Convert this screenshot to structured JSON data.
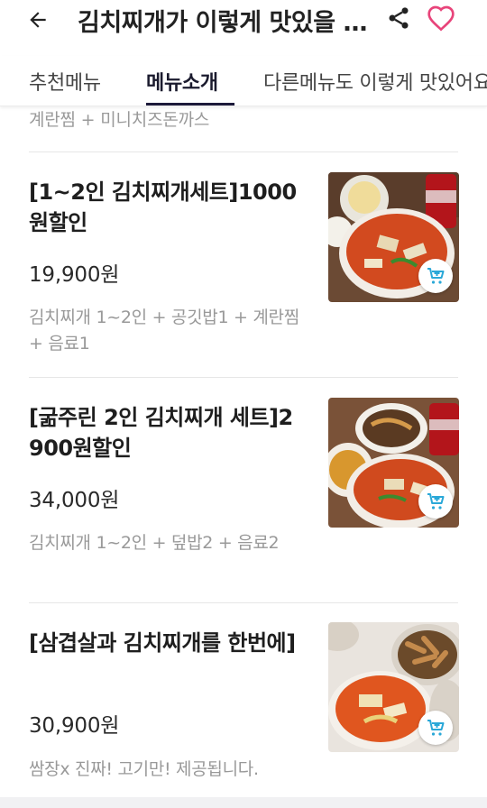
{
  "header": {
    "title": "김치찌개가 이렇게 맛있을 수 있나요",
    "back_icon": "back-arrow-icon",
    "share_icon": "share-icon",
    "heart_icon": "heart-outline-icon",
    "heart_color": "#e8447a"
  },
  "tabs": [
    {
      "label": "추천메뉴",
      "active": false
    },
    {
      "label": "메뉴소개",
      "active": true
    },
    {
      "label": "다른메뉴도 이렇게 맛있어요",
      "active": false
    }
  ],
  "previous_item_desc_tail": "계란찜 + 미니치즈돈까스",
  "menu_items": [
    {
      "name": "[1~2인 김치찌개세트]1000원할인",
      "price": "19,900원",
      "description": "김치찌개 1~2인 + 공깃밥1 + 계란찜 + 음료1",
      "cart_icon": "add-to-cart-icon"
    },
    {
      "name": "[굶주린 2인 김치찌개 세트]2900원할인",
      "price": "34,000원",
      "description": "김치찌개 1~2인 + 덮밥2 + 음료2",
      "cart_icon": "add-to-cart-icon"
    },
    {
      "name": "[삼겹살과 김치찌개를 한번에]",
      "price": "30,900원",
      "description": "쌈장x 진짜! 고기만! 제공됩니다.",
      "cart_icon": "add-to-cart-icon"
    }
  ],
  "colors": {
    "accent_underline": "#1c1a3a",
    "cart_icon": "#2aa8d8"
  }
}
